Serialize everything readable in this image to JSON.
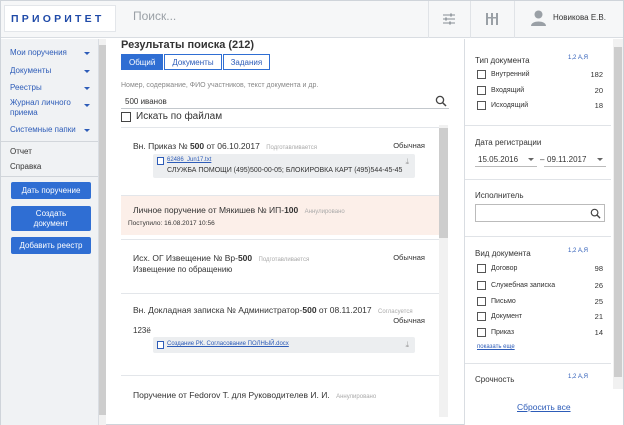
{
  "header": {
    "logo": "ПРИОРИТЕТ",
    "search_placeholder": "Поиск...",
    "user_name": "Новикова Е.В."
  },
  "sidebar": {
    "items": [
      {
        "label": "Мои поручения"
      },
      {
        "label": "Документы"
      },
      {
        "label": "Реестры"
      },
      {
        "label_line1": "Журнал личного",
        "label_line2": "приема"
      },
      {
        "label": "Системные папки"
      }
    ],
    "plain": [
      {
        "label": "Отчет"
      },
      {
        "label": "Справка"
      }
    ],
    "buttons": {
      "assign": "Дать поручение",
      "create_line1": "Создать",
      "create_line2": "документ",
      "add_registry": "Добавить реестр"
    }
  },
  "main": {
    "title": "Результаты поиска (212)",
    "tabs": [
      {
        "label": "Общий",
        "active": true
      },
      {
        "label": "Документы",
        "active": false
      },
      {
        "label": "Задания",
        "active": false
      }
    ],
    "search_hint": "Номер, содержание, ФИО участников, текст документа и др.",
    "search_value": "500 иванов",
    "search_files_label": "Искать по файлам",
    "results": [
      {
        "title_pre": "Вн. Приказ № ",
        "title_bold": "500",
        "title_post": " от 06.10.2017",
        "status": "Подготавливается",
        "right": "Обычная",
        "file": "62486_Jun17.txt",
        "snippet": "СЛУЖБА ПОМОЩИ (495)500-00-05; БЛОКИРОВКА КАРТ (495)544-45-45"
      },
      {
        "title_pre": "Личное поручение от Мякишев № ИП-",
        "title_bold": "100",
        "status": "Аннулировано",
        "sub": "Поступило: 16.08.2017 10:56"
      },
      {
        "title_pre": "Исх. ОГ Извещение № Вр-",
        "title_bold": "500",
        "status": "Подготавливается",
        "right": "Обычная",
        "sub": "Извещение по обращению"
      },
      {
        "title_pre": "Вн. Докладная записка № Администратор-",
        "title_bold": "500",
        "title_post": " от 08.11.2017",
        "status": "Согласуется",
        "right": "Обычная",
        "sub": "123ё",
        "file": "Создание РК. Согласование ПОЛНЫЙ.docx"
      },
      {
        "title_pre": "Поручение от Fedorov T. для Руководителев И. И.",
        "status": "Аннулировано"
      }
    ]
  },
  "filters": {
    "sort_label": "1,2  А,Я",
    "doc_type": {
      "title": "Тип документа",
      "options": [
        {
          "label": "Внутренний",
          "count": "182"
        },
        {
          "label": "Входящий",
          "count": "20"
        },
        {
          "label": "Исходящий",
          "count": "18"
        }
      ]
    },
    "reg_date": {
      "title": "Дата регистрации",
      "from": "15.05.2016",
      "to": "09.11.2017"
    },
    "executor": {
      "title": "Исполнитель"
    },
    "doc_kind": {
      "title": "Вид документа",
      "options": [
        {
          "label": "Договор",
          "count": "98"
        },
        {
          "label": "Служебная записка",
          "count": "26"
        },
        {
          "label": "Письмо",
          "count": "25"
        },
        {
          "label": "Документ",
          "count": "21"
        },
        {
          "label": "Приказ",
          "count": "14"
        }
      ],
      "more": "показать еще"
    },
    "urgency": {
      "title": "Срочность"
    },
    "reset": "Сбросить все"
  }
}
